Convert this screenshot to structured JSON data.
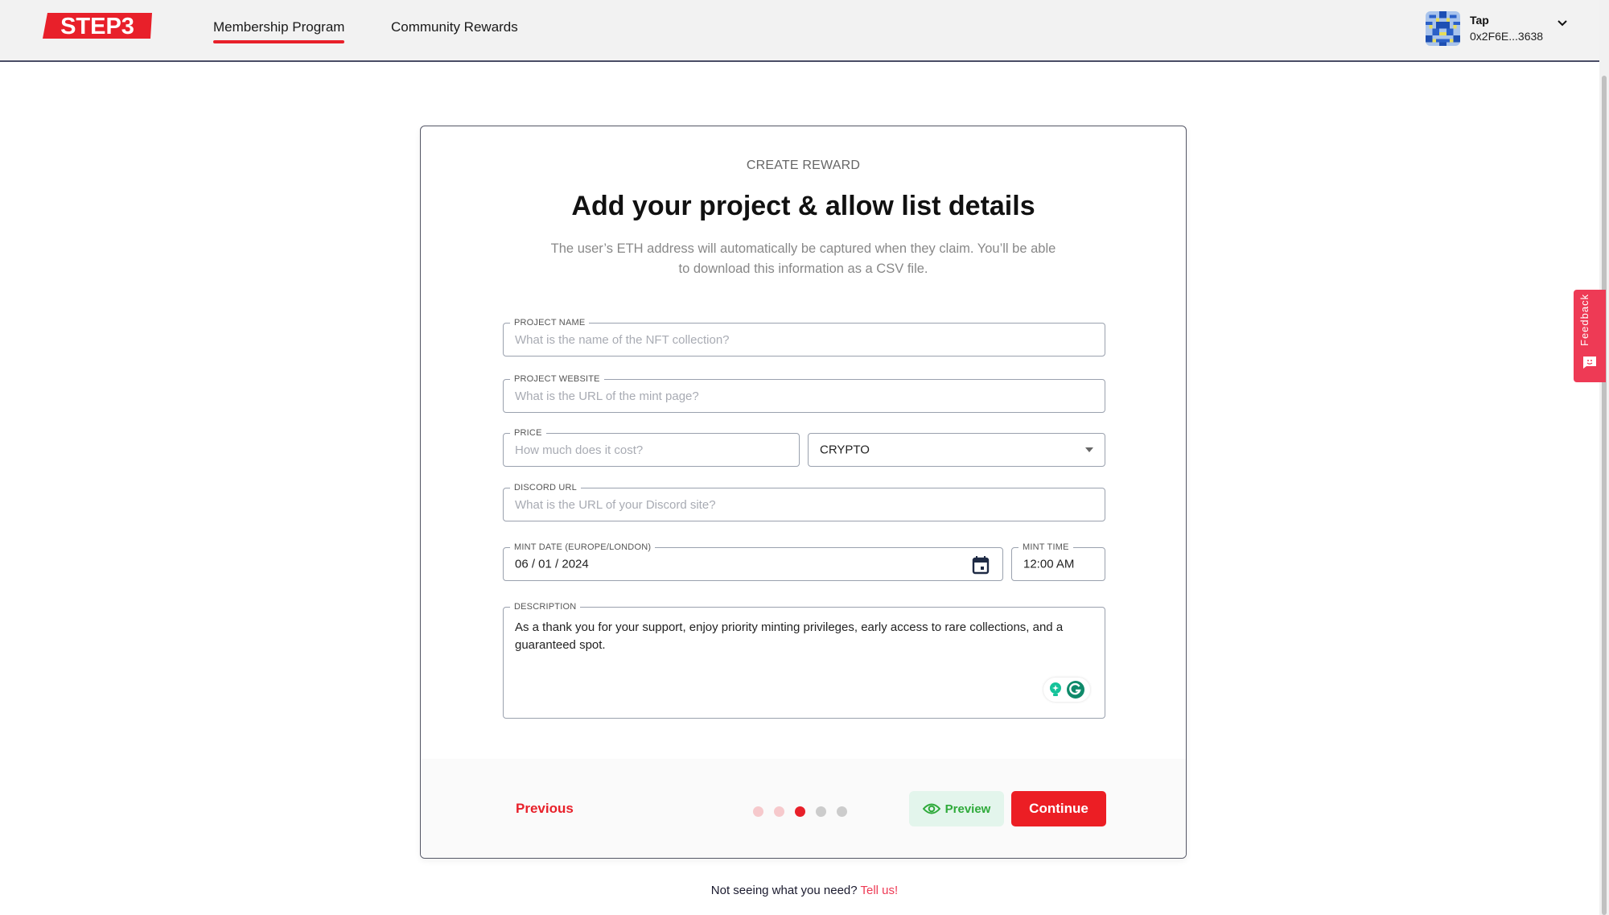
{
  "header": {
    "brand": "STEP3",
    "nav": [
      {
        "label": "Membership Program",
        "active": true
      },
      {
        "label": "Community Rewards",
        "active": false
      }
    ],
    "user": {
      "name": "Tap",
      "address": "0x2F6E...3638"
    }
  },
  "feedback": {
    "label": "Feedback"
  },
  "card": {
    "eyebrow": "CREATE REWARD",
    "title": "Add your project & allow list details",
    "subtitle": "The user’s ETH address will automatically be captured when they claim. You’ll be able to download this information as a CSV file.",
    "fields": {
      "project_name": {
        "label": "PROJECT NAME",
        "placeholder": "What is the name of the NFT collection?",
        "value": ""
      },
      "project_website": {
        "label": "PROJECT WEBSITE",
        "placeholder": "What is the URL of the mint page?",
        "value": ""
      },
      "price": {
        "label": "PRICE",
        "placeholder": "How much does it cost?",
        "value": ""
      },
      "currency": {
        "selected": "CRYPTO"
      },
      "discord_url": {
        "label": "DISCORD URL",
        "placeholder": "What is the URL of your Discord site?",
        "value": ""
      },
      "mint_date": {
        "label": "MINT DATE (EUROPE/LONDON)",
        "value": "06 / 01 / 2024"
      },
      "mint_time": {
        "label": "MINT TIME",
        "value": "12:00 AM"
      },
      "description": {
        "label": "DESCRIPTION",
        "value": "As a thank you for your support, enjoy priority minting privileges, early access to rare collections, and a guaranteed spot."
      }
    },
    "footer": {
      "previous_label": "Previous",
      "preview_label": "Preview",
      "continue_label": "Continue",
      "steps": {
        "total": 5,
        "current": 3
      }
    }
  },
  "bottom_note": {
    "text": "Not seeing what you need?",
    "link": "Tell us!"
  },
  "colors": {
    "brand_red": "#e8202a",
    "feedback_pink": "#ee3a55",
    "preview_green": "#2eaa3a",
    "preview_bg": "#e3f5ec",
    "step_done": "#f6c9cc",
    "step_current": "#e8202a",
    "step_pending": "#cccccc"
  }
}
